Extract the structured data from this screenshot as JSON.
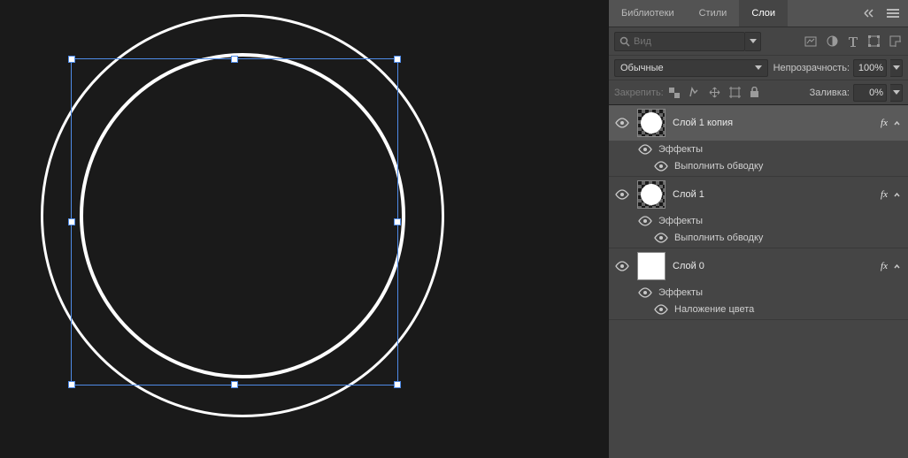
{
  "tabs": {
    "libraries": "Библиотеки",
    "styles": "Стили",
    "layers": "Слои"
  },
  "search": {
    "placeholder": "Вид"
  },
  "blend": {
    "value": "Обычные"
  },
  "opacity": {
    "label": "Непрозрачность:",
    "value": "100%"
  },
  "lock": {
    "label": "Закрепить:"
  },
  "fill": {
    "label": "Заливка:",
    "value": "0%"
  },
  "fx_label": "fx",
  "effects_label": "Эффекты",
  "layers_list": [
    {
      "name": "Слой 1 копия",
      "selected": true,
      "thumb": "checker-circle",
      "effects": [
        "Выполнить обводку"
      ]
    },
    {
      "name": "Слой 1",
      "selected": false,
      "thumb": "checker-circle",
      "effects": [
        "Выполнить обводку"
      ]
    },
    {
      "name": "Слой 0",
      "selected": false,
      "thumb": "white",
      "effects": [
        "Наложение цвета"
      ]
    }
  ]
}
